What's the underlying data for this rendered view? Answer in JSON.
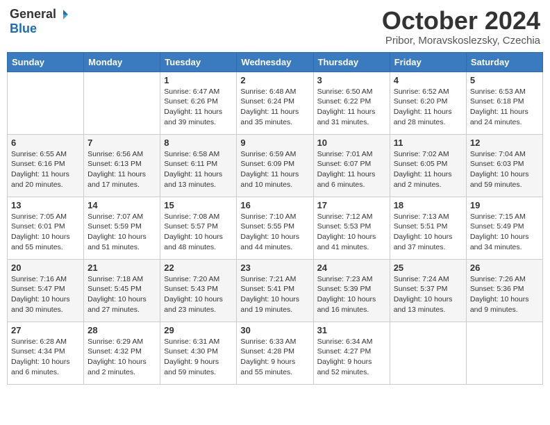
{
  "logo": {
    "general": "General",
    "blue": "Blue"
  },
  "title": "October 2024",
  "location": "Pribor, Moravskoslezsky, Czechia",
  "days_of_week": [
    "Sunday",
    "Monday",
    "Tuesday",
    "Wednesday",
    "Thursday",
    "Friday",
    "Saturday"
  ],
  "weeks": [
    [
      {
        "day": "",
        "sunrise": "",
        "sunset": "",
        "daylight": ""
      },
      {
        "day": "",
        "sunrise": "",
        "sunset": "",
        "daylight": ""
      },
      {
        "day": "1",
        "sunrise": "Sunrise: 6:47 AM",
        "sunset": "Sunset: 6:26 PM",
        "daylight": "Daylight: 11 hours and 39 minutes."
      },
      {
        "day": "2",
        "sunrise": "Sunrise: 6:48 AM",
        "sunset": "Sunset: 6:24 PM",
        "daylight": "Daylight: 11 hours and 35 minutes."
      },
      {
        "day": "3",
        "sunrise": "Sunrise: 6:50 AM",
        "sunset": "Sunset: 6:22 PM",
        "daylight": "Daylight: 11 hours and 31 minutes."
      },
      {
        "day": "4",
        "sunrise": "Sunrise: 6:52 AM",
        "sunset": "Sunset: 6:20 PM",
        "daylight": "Daylight: 11 hours and 28 minutes."
      },
      {
        "day": "5",
        "sunrise": "Sunrise: 6:53 AM",
        "sunset": "Sunset: 6:18 PM",
        "daylight": "Daylight: 11 hours and 24 minutes."
      }
    ],
    [
      {
        "day": "6",
        "sunrise": "Sunrise: 6:55 AM",
        "sunset": "Sunset: 6:16 PM",
        "daylight": "Daylight: 11 hours and 20 minutes."
      },
      {
        "day": "7",
        "sunrise": "Sunrise: 6:56 AM",
        "sunset": "Sunset: 6:13 PM",
        "daylight": "Daylight: 11 hours and 17 minutes."
      },
      {
        "day": "8",
        "sunrise": "Sunrise: 6:58 AM",
        "sunset": "Sunset: 6:11 PM",
        "daylight": "Daylight: 11 hours and 13 minutes."
      },
      {
        "day": "9",
        "sunrise": "Sunrise: 6:59 AM",
        "sunset": "Sunset: 6:09 PM",
        "daylight": "Daylight: 11 hours and 10 minutes."
      },
      {
        "day": "10",
        "sunrise": "Sunrise: 7:01 AM",
        "sunset": "Sunset: 6:07 PM",
        "daylight": "Daylight: 11 hours and 6 minutes."
      },
      {
        "day": "11",
        "sunrise": "Sunrise: 7:02 AM",
        "sunset": "Sunset: 6:05 PM",
        "daylight": "Daylight: 11 hours and 2 minutes."
      },
      {
        "day": "12",
        "sunrise": "Sunrise: 7:04 AM",
        "sunset": "Sunset: 6:03 PM",
        "daylight": "Daylight: 10 hours and 59 minutes."
      }
    ],
    [
      {
        "day": "13",
        "sunrise": "Sunrise: 7:05 AM",
        "sunset": "Sunset: 6:01 PM",
        "daylight": "Daylight: 10 hours and 55 minutes."
      },
      {
        "day": "14",
        "sunrise": "Sunrise: 7:07 AM",
        "sunset": "Sunset: 5:59 PM",
        "daylight": "Daylight: 10 hours and 51 minutes."
      },
      {
        "day": "15",
        "sunrise": "Sunrise: 7:08 AM",
        "sunset": "Sunset: 5:57 PM",
        "daylight": "Daylight: 10 hours and 48 minutes."
      },
      {
        "day": "16",
        "sunrise": "Sunrise: 7:10 AM",
        "sunset": "Sunset: 5:55 PM",
        "daylight": "Daylight: 10 hours and 44 minutes."
      },
      {
        "day": "17",
        "sunrise": "Sunrise: 7:12 AM",
        "sunset": "Sunset: 5:53 PM",
        "daylight": "Daylight: 10 hours and 41 minutes."
      },
      {
        "day": "18",
        "sunrise": "Sunrise: 7:13 AM",
        "sunset": "Sunset: 5:51 PM",
        "daylight": "Daylight: 10 hours and 37 minutes."
      },
      {
        "day": "19",
        "sunrise": "Sunrise: 7:15 AM",
        "sunset": "Sunset: 5:49 PM",
        "daylight": "Daylight: 10 hours and 34 minutes."
      }
    ],
    [
      {
        "day": "20",
        "sunrise": "Sunrise: 7:16 AM",
        "sunset": "Sunset: 5:47 PM",
        "daylight": "Daylight: 10 hours and 30 minutes."
      },
      {
        "day": "21",
        "sunrise": "Sunrise: 7:18 AM",
        "sunset": "Sunset: 5:45 PM",
        "daylight": "Daylight: 10 hours and 27 minutes."
      },
      {
        "day": "22",
        "sunrise": "Sunrise: 7:20 AM",
        "sunset": "Sunset: 5:43 PM",
        "daylight": "Daylight: 10 hours and 23 minutes."
      },
      {
        "day": "23",
        "sunrise": "Sunrise: 7:21 AM",
        "sunset": "Sunset: 5:41 PM",
        "daylight": "Daylight: 10 hours and 19 minutes."
      },
      {
        "day": "24",
        "sunrise": "Sunrise: 7:23 AM",
        "sunset": "Sunset: 5:39 PM",
        "daylight": "Daylight: 10 hours and 16 minutes."
      },
      {
        "day": "25",
        "sunrise": "Sunrise: 7:24 AM",
        "sunset": "Sunset: 5:37 PM",
        "daylight": "Daylight: 10 hours and 13 minutes."
      },
      {
        "day": "26",
        "sunrise": "Sunrise: 7:26 AM",
        "sunset": "Sunset: 5:36 PM",
        "daylight": "Daylight: 10 hours and 9 minutes."
      }
    ],
    [
      {
        "day": "27",
        "sunrise": "Sunrise: 6:28 AM",
        "sunset": "Sunset: 4:34 PM",
        "daylight": "Daylight: 10 hours and 6 minutes."
      },
      {
        "day": "28",
        "sunrise": "Sunrise: 6:29 AM",
        "sunset": "Sunset: 4:32 PM",
        "daylight": "Daylight: 10 hours and 2 minutes."
      },
      {
        "day": "29",
        "sunrise": "Sunrise: 6:31 AM",
        "sunset": "Sunset: 4:30 PM",
        "daylight": "Daylight: 9 hours and 59 minutes."
      },
      {
        "day": "30",
        "sunrise": "Sunrise: 6:33 AM",
        "sunset": "Sunset: 4:28 PM",
        "daylight": "Daylight: 9 hours and 55 minutes."
      },
      {
        "day": "31",
        "sunrise": "Sunrise: 6:34 AM",
        "sunset": "Sunset: 4:27 PM",
        "daylight": "Daylight: 9 hours and 52 minutes."
      },
      {
        "day": "",
        "sunrise": "",
        "sunset": "",
        "daylight": ""
      },
      {
        "day": "",
        "sunrise": "",
        "sunset": "",
        "daylight": ""
      }
    ]
  ]
}
